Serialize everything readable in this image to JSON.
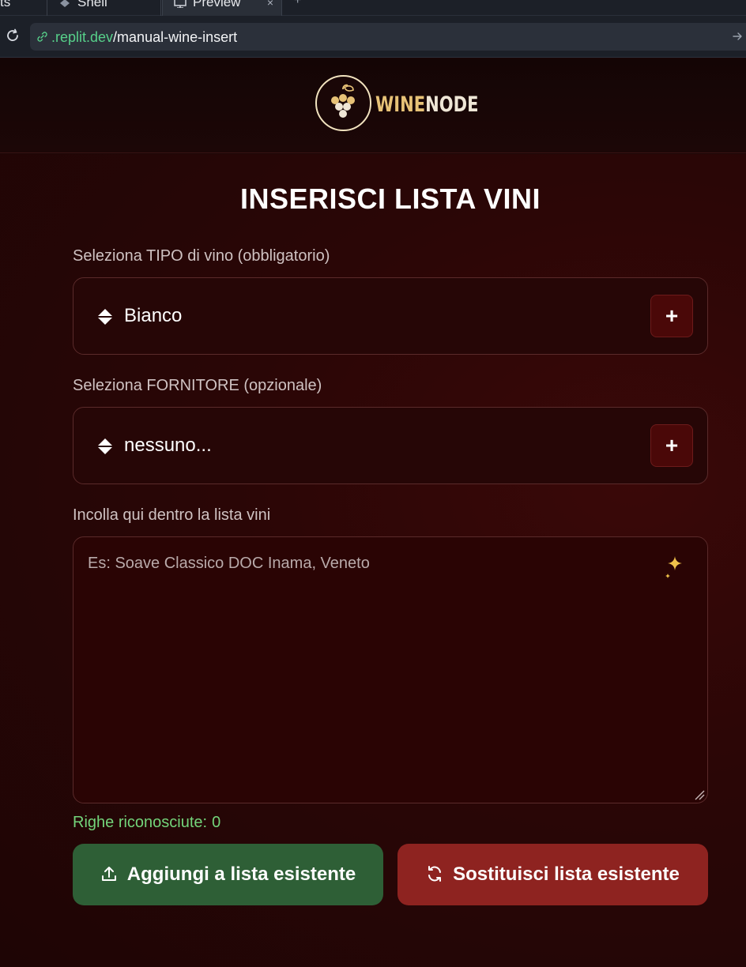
{
  "browser": {
    "tabs": [
      {
        "label": "ts"
      },
      {
        "label": "Shell"
      },
      {
        "label": "Preview"
      }
    ],
    "new_tab_label": "+",
    "url_host": ".replit.dev",
    "url_path": "/manual-wine-insert"
  },
  "header": {
    "logo_word_1": "WINE",
    "logo_word_2": "NODE"
  },
  "page": {
    "title": "INSERISCI LISTA VINI",
    "type_label": "Seleziona TIPO di vino (obbligatorio)",
    "type_value": "Bianco",
    "supplier_label": "Seleziona FORNITORE (opzionale)",
    "supplier_value": "nessuno...",
    "add_symbol": "+",
    "list_label": "Incolla qui dentro la lista vini",
    "list_placeholder": "Es: Soave Classico DOC Inama, Veneto",
    "counter_label": "Righe riconosciute:",
    "counter_value": "0",
    "append_button": "Aggiungi a lista esistente",
    "replace_button": "Sostituisci lista esistente"
  },
  "colors": {
    "accent_gold": "#e7c277",
    "append_green": "#2e5f36",
    "replace_red": "#8e2320",
    "counter_green": "#73d47a"
  },
  "icons": [
    "reload-icon",
    "link-icon",
    "go-arrow-icon",
    "grape-logo-icon",
    "sort-arrows-icon",
    "plus-icon",
    "sparkle-icon",
    "upload-icon",
    "refresh-icon",
    "resize-handle-icon"
  ]
}
